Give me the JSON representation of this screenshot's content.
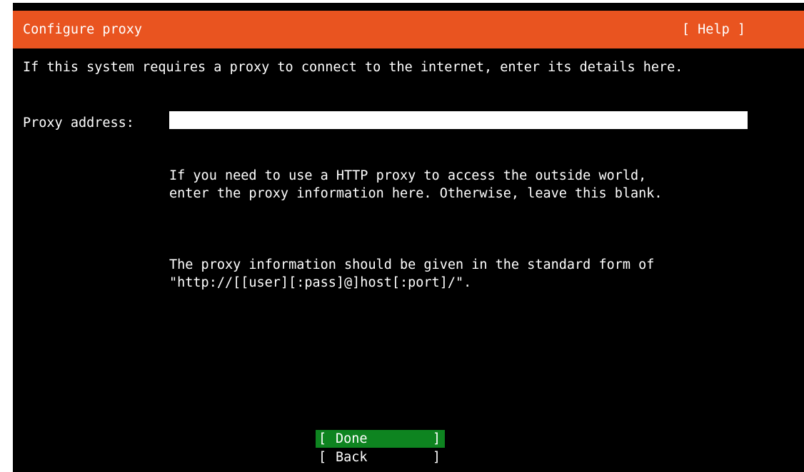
{
  "header": {
    "title": "Configure proxy",
    "help_label": "[ Help ]"
  },
  "intro_text": "If this system requires a proxy to connect to the internet, enter its details here.",
  "proxy": {
    "label": "Proxy address:",
    "value": "",
    "placeholder": "",
    "help_line1": "If you need to use a HTTP proxy to access the outside world,\nenter the proxy information here. Otherwise, leave this blank.",
    "help_line2": "The proxy information should be given in the standard form of\n\"http://[[user][:pass]@]host[:port]/\"."
  },
  "buttons": {
    "done_label": "Done",
    "back_label": "Back",
    "bracket_left": "[",
    "bracket_right": "]"
  },
  "colors": {
    "title_bar": "#e95420",
    "selected_button": "#0e8420",
    "background": "#000000",
    "text": "#ffffff"
  }
}
